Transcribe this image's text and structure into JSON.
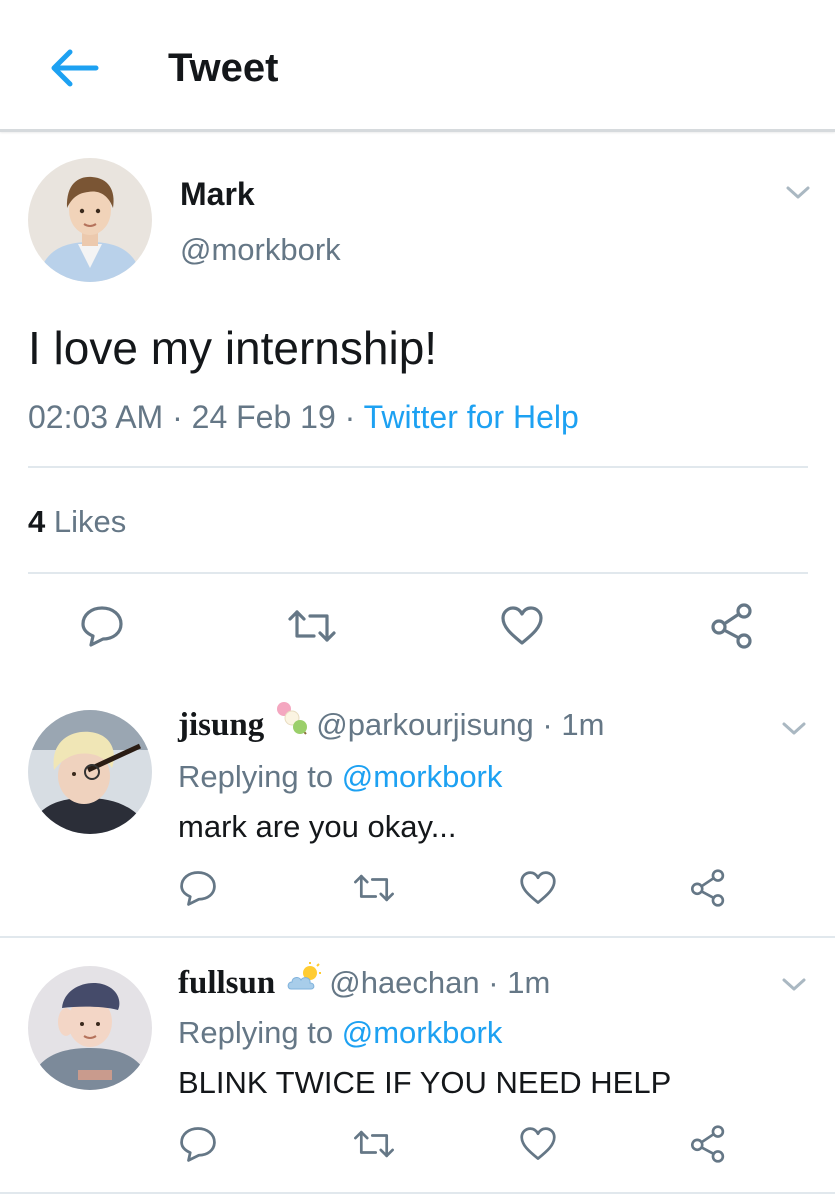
{
  "header": {
    "title": "Tweet",
    "back_icon": "arrow-left-icon"
  },
  "tweet": {
    "display_name": "Mark",
    "handle": "@morkbork",
    "text": "I love my internship!",
    "time": "02:03 AM",
    "date": "24 Feb 19",
    "separator": " · ",
    "source": "Twitter for Help",
    "likes_count": "4",
    "likes_label": "Likes"
  },
  "replies": [
    {
      "display_name": "jisung",
      "emoji": "dango-emoji",
      "handle": "@parkourjisung",
      "time": "· 1m",
      "replying_prefix": "Replying to",
      "replying_to": "@morkbork",
      "text": "mark are you okay..."
    },
    {
      "display_name": "fullsun",
      "emoji": "sun-behind-cloud-emoji",
      "handle": "@haechan",
      "time": "· 1m",
      "replying_prefix": "Replying to",
      "replying_to": "@morkbork",
      "text": "BLINK TWICE IF YOU NEED HELP"
    }
  ],
  "colors": {
    "accent": "#1da1f2",
    "text": "#14171a",
    "muted": "#657786",
    "divider": "#e1e8ed"
  }
}
